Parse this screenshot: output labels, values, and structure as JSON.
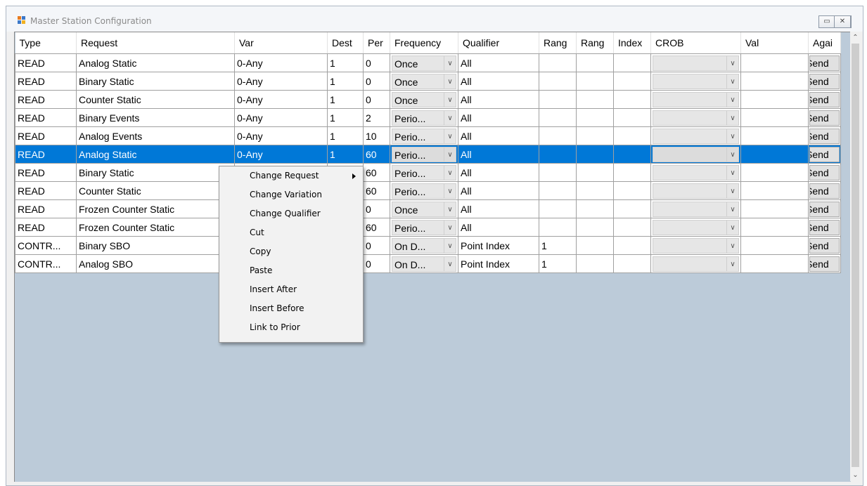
{
  "window": {
    "title": "Master Station Configuration",
    "controls": {
      "minimize": "▭",
      "maximize": "◻",
      "close": "✕"
    }
  },
  "grid": {
    "columns": [
      "Type",
      "Request",
      "Var",
      "Dest",
      "Per",
      "Frequency",
      "Qualifier",
      "Rang",
      "Rang",
      "Index",
      "CROB",
      "Val",
      "Agai"
    ],
    "rows": [
      {
        "type": "READ",
        "request": "Analog Static",
        "var": "0-Any",
        "dest": "1",
        "per": "0",
        "frequency": "Once",
        "qualifier": "All",
        "range_start": "",
        "range_stop": "",
        "index": "",
        "crob": "",
        "val": "",
        "again": "Send"
      },
      {
        "type": "READ",
        "request": "Binary Static",
        "var": "0-Any",
        "dest": "1",
        "per": "0",
        "frequency": "Once",
        "qualifier": "All",
        "range_start": "",
        "range_stop": "",
        "index": "",
        "crob": "",
        "val": "",
        "again": "Send"
      },
      {
        "type": "READ",
        "request": "Counter Static",
        "var": "0-Any",
        "dest": "1",
        "per": "0",
        "frequency": "Once",
        "qualifier": "All",
        "range_start": "",
        "range_stop": "",
        "index": "",
        "crob": "",
        "val": "",
        "again": "Send"
      },
      {
        "type": "READ",
        "request": "Binary Events",
        "var": "0-Any",
        "dest": "1",
        "per": "2",
        "frequency": "Perio...",
        "qualifier": "All",
        "range_start": "",
        "range_stop": "",
        "index": "",
        "crob": "",
        "val": "",
        "again": "Send"
      },
      {
        "type": "READ",
        "request": "Analog Events",
        "var": "0-Any",
        "dest": "1",
        "per": "10",
        "frequency": "Perio...",
        "qualifier": "All",
        "range_start": "",
        "range_stop": "",
        "index": "",
        "crob": "",
        "val": "",
        "again": "Send"
      },
      {
        "type": "READ",
        "request": "Analog Static",
        "var": "0-Any",
        "dest": "1",
        "per": "60",
        "frequency": "Perio...",
        "qualifier": "All",
        "range_start": "",
        "range_stop": "",
        "index": "",
        "crob": "",
        "val": "",
        "again": "Send",
        "selected": true
      },
      {
        "type": "READ",
        "request": "Binary Static",
        "var": "",
        "dest": "",
        "per": "60",
        "frequency": "Perio...",
        "qualifier": "All",
        "range_start": "",
        "range_stop": "",
        "index": "",
        "crob": "",
        "val": "",
        "again": "Send"
      },
      {
        "type": "READ",
        "request": "Counter Static",
        "var": "",
        "dest": "",
        "per": "60",
        "frequency": "Perio...",
        "qualifier": "All",
        "range_start": "",
        "range_stop": "",
        "index": "",
        "crob": "",
        "val": "",
        "again": "Send"
      },
      {
        "type": "READ",
        "request": "Frozen Counter Static",
        "var": "",
        "dest": "",
        "per": "0",
        "frequency": "Once",
        "qualifier": "All",
        "range_start": "",
        "range_stop": "",
        "index": "",
        "crob": "",
        "val": "",
        "again": "Send"
      },
      {
        "type": "READ",
        "request": "Frozen Counter Static",
        "var": "",
        "dest": "",
        "per": "60",
        "frequency": "Perio...",
        "qualifier": "All",
        "range_start": "",
        "range_stop": "",
        "index": "",
        "crob": "",
        "val": "",
        "again": "Send"
      },
      {
        "type": "CONTR...",
        "request": "Binary SBO",
        "var": "",
        "dest": "",
        "per": "0",
        "frequency": "On D...",
        "qualifier": "Point Index",
        "range_start": "1",
        "range_stop": "",
        "index": "",
        "crob": "",
        "val": "",
        "again": "Send"
      },
      {
        "type": "CONTR...",
        "request": "Analog SBO",
        "var": "",
        "dest": "",
        "per": "0",
        "frequency": "On D...",
        "qualifier": "Point Index",
        "range_start": "1",
        "range_stop": "",
        "index": "",
        "crob": "",
        "val": "",
        "again": "Send"
      }
    ]
  },
  "context_menu": {
    "items": [
      "Change Request",
      "Change Variation",
      "Change Qualifier",
      "Cut",
      "Copy",
      "Paste",
      "Insert After",
      "Insert Before",
      "Link to Prior"
    ]
  },
  "scrollbar": {
    "up_icon": "⌃",
    "down_icon": "⌄"
  },
  "colors": {
    "selection": "#0078d7",
    "grid_background": "#bccbd9"
  }
}
